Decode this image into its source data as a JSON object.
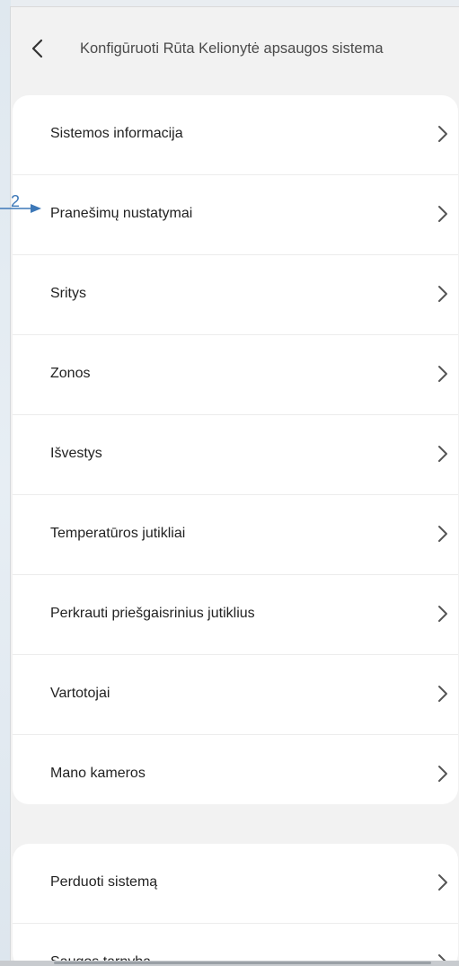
{
  "header": {
    "title": "Konfigūruoti Rūta Kelionytė apsaugos sistema",
    "back_icon": "chevron-left-icon"
  },
  "menu_primary": [
    {
      "label": "Sistemos informacija"
    },
    {
      "label": "Pranešimų nustatymai"
    },
    {
      "label": "Sritys"
    },
    {
      "label": "Zonos"
    },
    {
      "label": "Išvestys"
    },
    {
      "label": "Temperatūros jutikliai"
    },
    {
      "label": "Perkrauti priešgaisrinius jutiklius"
    },
    {
      "label": "Vartotojai"
    },
    {
      "label": "Mano kameros"
    }
  ],
  "menu_secondary": [
    {
      "label": "Perduoti sistemą"
    },
    {
      "label": "Saugos tarnyba"
    }
  ],
  "annotation": {
    "number": "2",
    "color": "#3d78b8"
  },
  "colors": {
    "background": "#f2f2f2",
    "card": "#ffffff",
    "text": "#222222",
    "chevron": "#555555"
  }
}
